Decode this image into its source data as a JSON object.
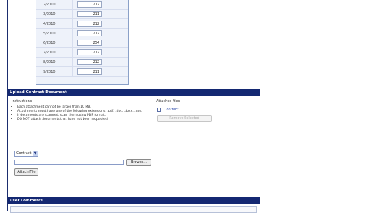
{
  "monthly_table": {
    "rows": [
      {
        "date": "2/2010",
        "value": "212"
      },
      {
        "date": "3/2010",
        "value": "211"
      },
      {
        "date": "4/2010",
        "value": "212"
      },
      {
        "date": "5/2010",
        "value": "212"
      },
      {
        "date": "6/2010",
        "value": "254"
      },
      {
        "date": "7/2010",
        "value": "212"
      },
      {
        "date": "8/2010",
        "value": "212"
      },
      {
        "date": "9/2010",
        "value": "211"
      }
    ]
  },
  "upload_section": {
    "title": "Upload Contract Document",
    "instructions_label": "Instructions",
    "instructions": [
      "Each attachment cannot be larger than 10 MB.",
      "Attachments must have one of the following extensions: .pdf, .doc, .docx, .xps.",
      "If documents are scanned, scan them using PDF format.",
      "DO NOT attach documents that have not been requested."
    ],
    "attached_files_label": "Attached files",
    "attached_file": "Contract",
    "remove_button": "Remove Selected",
    "doc_type_selected": "Contract",
    "browse_button": "Browse...",
    "attach_button": "Attach File"
  },
  "comments_section": {
    "title": "User Comments"
  },
  "colors": {
    "header_bg": "#142872",
    "link": "#2a48a8"
  }
}
